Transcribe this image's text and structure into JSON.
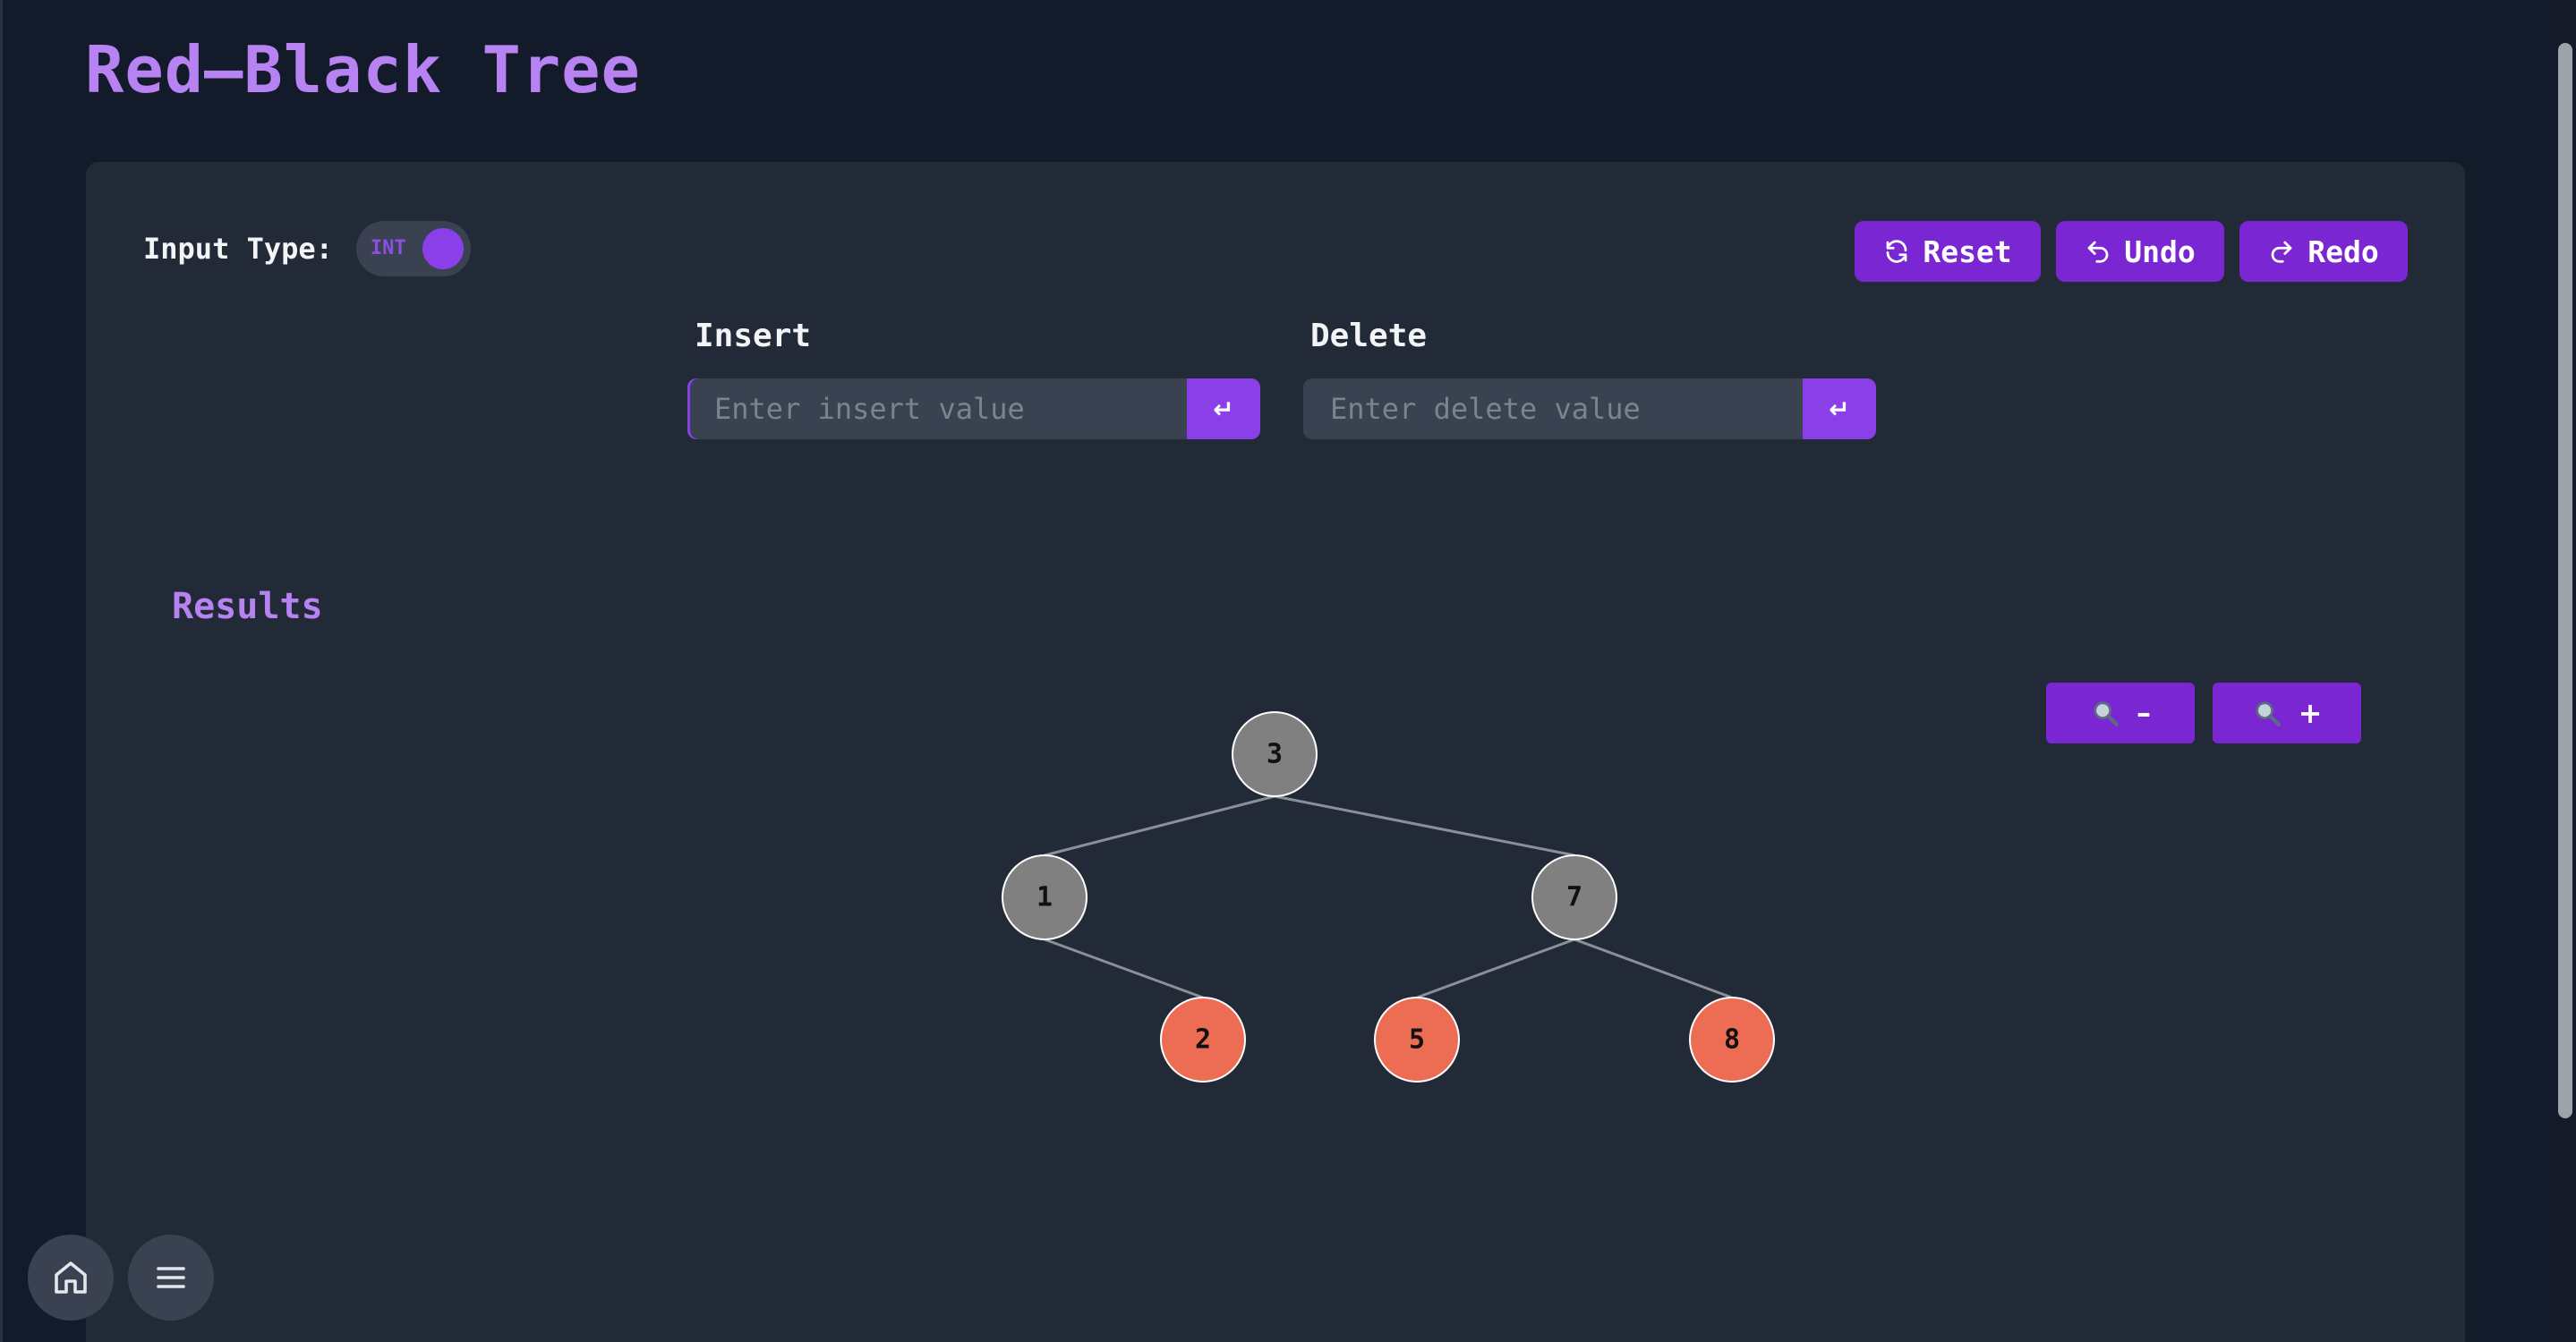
{
  "page": {
    "title": "Red–Black Tree"
  },
  "controls": {
    "input_type_label": "Input Type:",
    "toggle_value": "INT",
    "reset_label": "Reset",
    "undo_label": "Undo",
    "redo_label": "Redo"
  },
  "insert": {
    "label": "Insert",
    "placeholder": "Enter insert value",
    "value": "",
    "submit_symbol": "↵"
  },
  "delete": {
    "label": "Delete",
    "placeholder": "Enter delete value",
    "value": "",
    "submit_symbol": "↵"
  },
  "results": {
    "title": "Results",
    "zoom_out_symbol": "–",
    "zoom_in_symbol": "+"
  },
  "tree": {
    "nodes": [
      {
        "id": "n3",
        "value": "3",
        "color": "black",
        "parent": null,
        "side": null
      },
      {
        "id": "n1",
        "value": "1",
        "color": "black",
        "parent": "n3",
        "side": "left"
      },
      {
        "id": "n7",
        "value": "7",
        "color": "black",
        "parent": "n3",
        "side": "right"
      },
      {
        "id": "n2",
        "value": "2",
        "color": "red",
        "parent": "n1",
        "side": "right"
      },
      {
        "id": "n5",
        "value": "5",
        "color": "red",
        "parent": "n7",
        "side": "left"
      },
      {
        "id": "n8",
        "value": "8",
        "color": "red",
        "parent": "n7",
        "side": "right"
      }
    ]
  },
  "colors": {
    "accent": "#7b26d3",
    "title": "#b782f2",
    "background": "#131a29",
    "panel": "#222937",
    "black_node_fill": "#808080",
    "red_node_fill": "#ec6d53",
    "node_stroke": "#ffffff",
    "edge": "#8a8f98"
  },
  "icons": {
    "reset": "refresh-icon",
    "undo": "undo-icon",
    "redo": "redo-icon",
    "zoom": "magnifier-icon",
    "home": "home-icon",
    "menu": "hamburger-menu-icon"
  }
}
